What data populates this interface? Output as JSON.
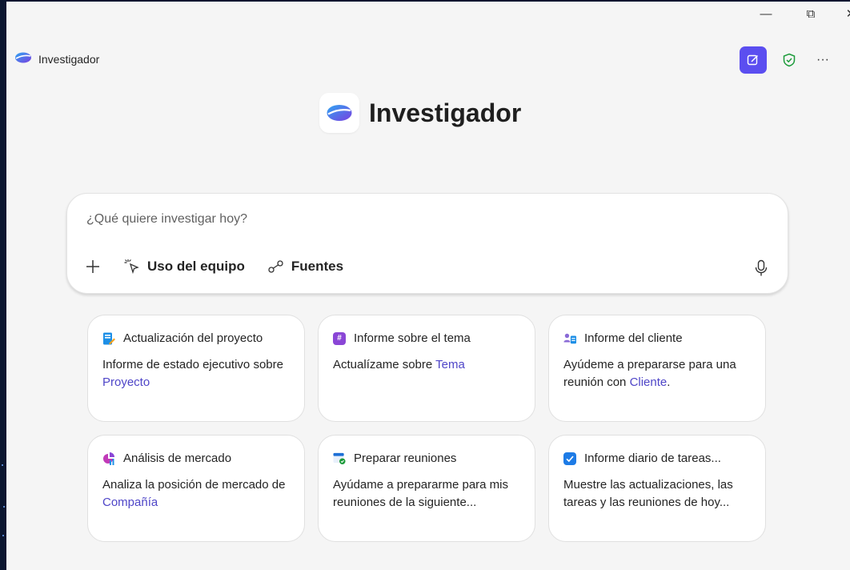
{
  "app": {
    "name": "Investigador",
    "hero_title": "Investigador"
  },
  "window_controls": {
    "minimize": "—",
    "restore": "⧉",
    "close": "✕"
  },
  "toolbar": {
    "new_chat_icon": "edit-icon",
    "shield_icon": "shield-check-icon",
    "more": "···"
  },
  "prompt": {
    "placeholder": "¿Qué quiere investigar hoy?",
    "value": "",
    "tools": [
      {
        "label": "Uso del equipo",
        "icon": "cursor-click-icon"
      },
      {
        "label": "Fuentes",
        "icon": "sources-icon"
      }
    ]
  },
  "cards": [
    {
      "title": "Actualización del proyecto",
      "body_pre": "Informe de estado ejecutivo sobre ",
      "body_link": "Proyecto",
      "body_post": ""
    },
    {
      "title": "Informe sobre el tema",
      "body_pre": "Actualízame sobre ",
      "body_link": "Tema",
      "body_post": ""
    },
    {
      "title": "Informe del cliente",
      "body_pre": "Ayúdeme a prepararse para una reunión con ",
      "body_link": "Cliente",
      "body_post": "."
    },
    {
      "title": "Análisis de mercado",
      "body_pre": "Analiza la posición de mercado de ",
      "body_link": "Compañía",
      "body_post": ""
    },
    {
      "title": "Preparar reuniones",
      "body_pre": "Ayúdame a prepararme para mis reuniones de la siguiente...",
      "body_link": "",
      "body_post": ""
    },
    {
      "title": "Informe diario de tareas...",
      "body_pre": "Muestre las actualizaciones, las tareas y las reuniones de hoy...",
      "body_link": "",
      "body_post": ""
    }
  ],
  "colors": {
    "accent": "#5b4ef0",
    "link": "#4f46c8",
    "shield": "#1c9b3a"
  }
}
